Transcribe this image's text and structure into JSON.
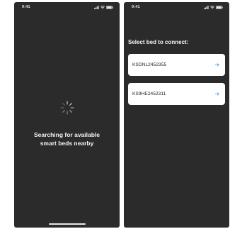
{
  "colors": {
    "screen_bg": "#2b2b2b",
    "card_bg": "#ffffff",
    "accent_arrow": "#3c8fe0",
    "text_light": "#f2f2f2"
  },
  "searching_screen": {
    "status_time": "9:41",
    "status_icons": [
      "signal-icon",
      "wifi-icon",
      "battery-icon"
    ],
    "spinner_icon": "loading-spinner-icon",
    "message_line1": "Searching for available",
    "message_line2": "smart beds nearby"
  },
  "select_screen": {
    "status_time": "9:41",
    "status_icons": [
      "signal-icon",
      "wifi-icon",
      "battery-icon"
    ],
    "title": "Select bed to connect:",
    "beds": [
      {
        "name": "KSDNL2452355",
        "icon": "arrow-right-icon"
      },
      {
        "name": "KS9HE2452311",
        "icon": "arrow-right-icon"
      }
    ]
  }
}
